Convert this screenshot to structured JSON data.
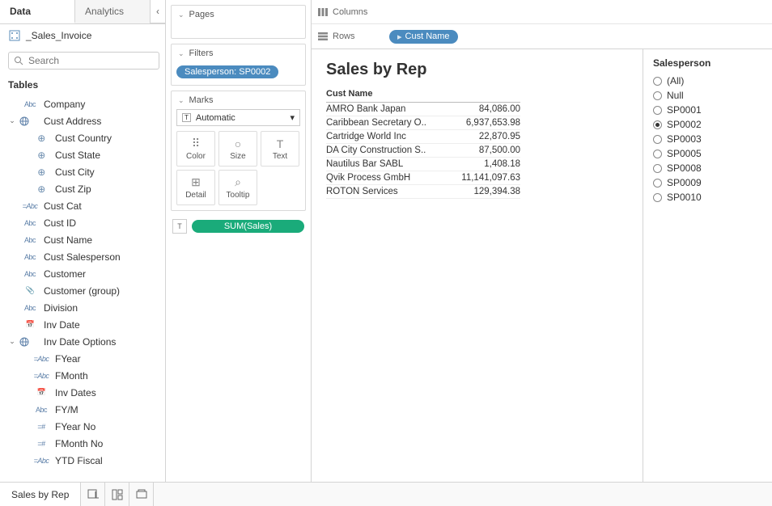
{
  "dataPanel": {
    "tabs": {
      "data": "Data",
      "analytics": "Analytics"
    },
    "datasource": "_Sales_Invoice",
    "searchPlaceholder": "Search",
    "tablesHeader": "Tables",
    "fields": [
      {
        "type": "str",
        "icon": "Abc",
        "name": "Company",
        "indent": 0,
        "caret": ""
      },
      {
        "type": "folder",
        "icon": "⌄",
        "name": "Cust Address",
        "indent": 0,
        "caret": "⌄",
        "globe": true
      },
      {
        "type": "globe",
        "icon": "⊕",
        "name": "Cust Country",
        "indent": 1,
        "caret": ""
      },
      {
        "type": "globe",
        "icon": "⊕",
        "name": "Cust State",
        "indent": 1,
        "caret": ""
      },
      {
        "type": "globe",
        "icon": "⊕",
        "name": "Cust City",
        "indent": 1,
        "caret": ""
      },
      {
        "type": "globe",
        "icon": "⊕",
        "name": "Cust Zip",
        "indent": 1,
        "caret": ""
      },
      {
        "type": "calc",
        "icon": "=Abc",
        "name": "Cust Cat",
        "indent": 0,
        "caret": ""
      },
      {
        "type": "str",
        "icon": "Abc",
        "name": "Cust ID",
        "indent": 0,
        "caret": ""
      },
      {
        "type": "str",
        "icon": "Abc",
        "name": "Cust Name",
        "indent": 0,
        "caret": ""
      },
      {
        "type": "str",
        "icon": "Abc",
        "name": "Cust Salesperson",
        "indent": 0,
        "caret": ""
      },
      {
        "type": "str",
        "icon": "Abc",
        "name": "Customer",
        "indent": 0,
        "caret": ""
      },
      {
        "type": "clip",
        "icon": "📎",
        "name": "Customer (group)",
        "indent": 0,
        "caret": ""
      },
      {
        "type": "str",
        "icon": "Abc",
        "name": "Division",
        "indent": 0,
        "caret": ""
      },
      {
        "type": "date",
        "icon": "📅",
        "name": "Inv Date",
        "indent": 0,
        "caret": ""
      },
      {
        "type": "folder",
        "icon": "⌄",
        "name": "Inv Date Options",
        "indent": 0,
        "caret": "⌄",
        "globe": true
      },
      {
        "type": "calc",
        "icon": "=Abc",
        "name": "FYear",
        "indent": 1,
        "caret": ""
      },
      {
        "type": "calc",
        "icon": "=Abc",
        "name": "FMonth",
        "indent": 1,
        "caret": ""
      },
      {
        "type": "date",
        "icon": "📅",
        "name": "Inv Dates",
        "indent": 1,
        "caret": ""
      },
      {
        "type": "str",
        "icon": "Abc",
        "name": "FY/M",
        "indent": 1,
        "caret": ""
      },
      {
        "type": "hash",
        "icon": "=#",
        "name": "FYear No",
        "indent": 1,
        "caret": ""
      },
      {
        "type": "hash",
        "icon": "=#",
        "name": "FMonth No",
        "indent": 1,
        "caret": ""
      },
      {
        "type": "calc",
        "icon": "=Abc",
        "name": "YTD Fiscal",
        "indent": 1,
        "caret": ""
      }
    ]
  },
  "shelves": {
    "pages": "Pages",
    "filters": "Filters",
    "filterPill": "Salesperson: SP0002",
    "marks": "Marks",
    "marksType": "Automatic",
    "markButtons": [
      "Color",
      "Size",
      "Text",
      "Detail",
      "Tooltip"
    ],
    "sumPill": "SUM(Sales)"
  },
  "canvas": {
    "columnsLabel": "Columns",
    "rowsLabel": "Rows",
    "rowPill": "Cust Name",
    "title": "Sales by Rep",
    "tableHeader": "Cust Name",
    "rows": [
      {
        "name": "AMRO Bank Japan",
        "val": "84,086.00"
      },
      {
        "name": "Caribbean Secretary O..",
        "val": "6,937,653.98"
      },
      {
        "name": "Cartridge World Inc",
        "val": "22,870.95"
      },
      {
        "name": "DA City Construction S..",
        "val": "87,500.00"
      },
      {
        "name": "Nautilus Bar SABL",
        "val": "1,408.18"
      },
      {
        "name": "Qvik Process GmbH",
        "val": "11,141,097.63"
      },
      {
        "name": "ROTON Services",
        "val": "129,394.38"
      }
    ]
  },
  "filterCard": {
    "title": "Salesperson",
    "options": [
      "(All)",
      "Null",
      "SP0001",
      "SP0002",
      "SP0003",
      "SP0005",
      "SP0008",
      "SP0009",
      "SP0010"
    ],
    "selected": "SP0002"
  },
  "bottom": {
    "sheet": "Sales by Rep"
  }
}
